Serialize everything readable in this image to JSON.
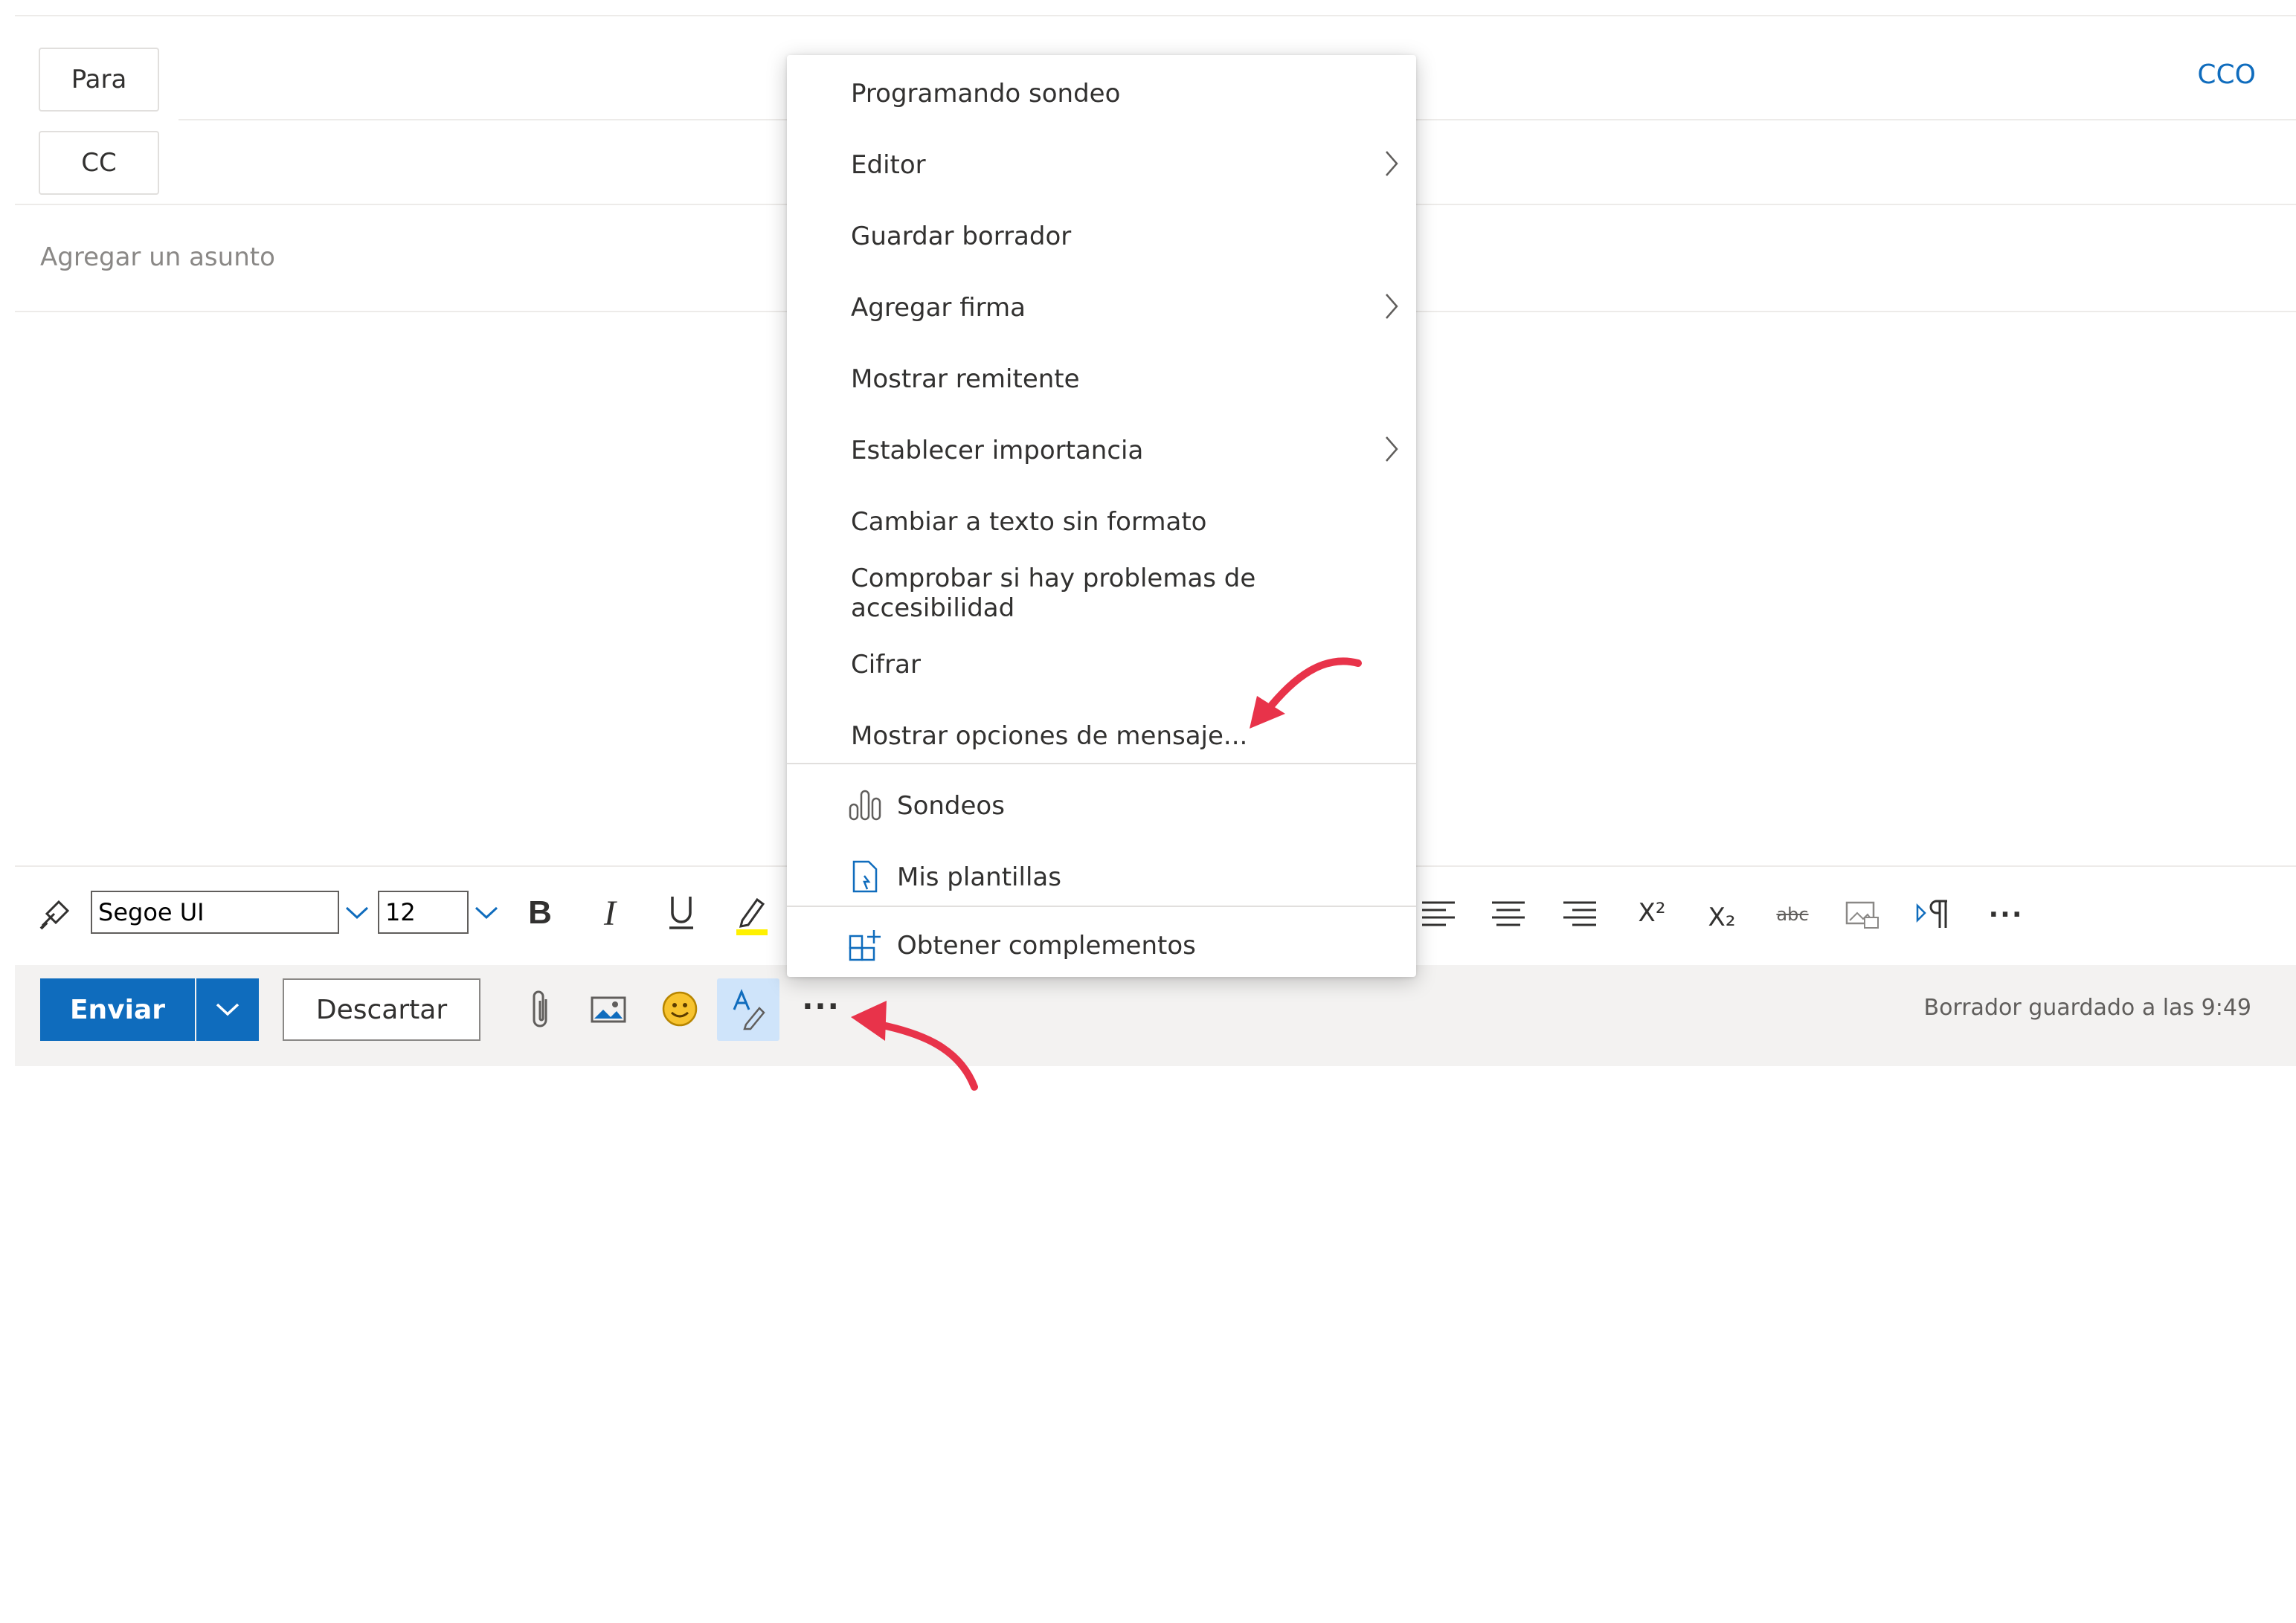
{
  "recipients": {
    "to_label": "Para",
    "cc_label": "CC",
    "bcc_label": "CCO"
  },
  "subject": {
    "placeholder": "Agregar un asunto"
  },
  "format_toolbar": {
    "font_name": "Segoe UI",
    "font_size": "12",
    "superscript_label": "X²",
    "subscript_label": "X₂",
    "strikethrough_label": "abc"
  },
  "actions": {
    "send_label": "Enviar",
    "discard_label": "Descartar",
    "more_label": "···",
    "status_text": "Borrador guardado a las 9:49"
  },
  "menu": {
    "items": [
      {
        "label": "Programando sondeo",
        "submenu": false
      },
      {
        "label": "Editor",
        "submenu": true
      },
      {
        "label": "Guardar borrador",
        "submenu": false
      },
      {
        "label": "Agregar firma",
        "submenu": true
      },
      {
        "label": "Mostrar remitente",
        "submenu": false
      },
      {
        "label": "Establecer importancia",
        "submenu": true
      },
      {
        "label": "Cambiar a texto sin formato",
        "submenu": false
      },
      {
        "label": "Comprobar si hay problemas de accesibilidad",
        "submenu": false
      },
      {
        "label": "Cifrar",
        "submenu": false
      },
      {
        "label": "Mostrar opciones de mensaje...",
        "submenu": false
      }
    ],
    "apps": [
      {
        "label": "Sondeos",
        "icon": "poll-icon"
      },
      {
        "label": "Mis plantillas",
        "icon": "template-icon"
      }
    ],
    "addins": {
      "label": "Obtener complementos",
      "icon": "addins-grid-icon"
    }
  },
  "colors": {
    "accent": "#0f6cbd",
    "annotation_arrow": "#e8334a",
    "highlight_marker": "#fff100"
  }
}
